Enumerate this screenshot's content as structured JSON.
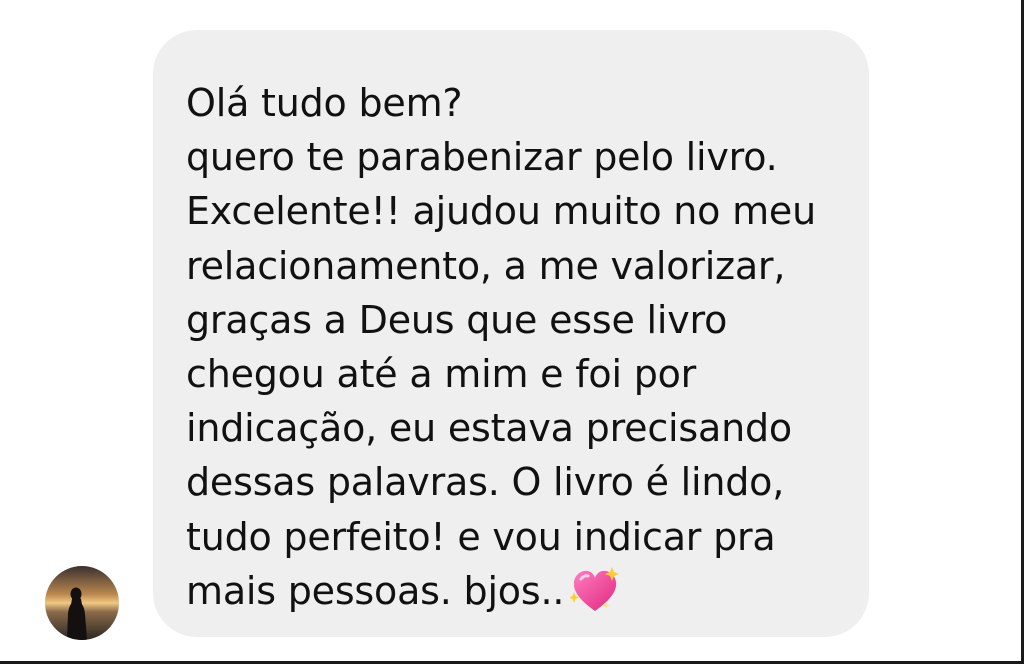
{
  "message": {
    "lines": [
      "Olá tudo bem?",
      "quero te parabenizar pelo livro.",
      "Excelente!! ajudou muito no meu",
      "relacionamento, a me valorizar,",
      "graças a Deus que esse livro",
      "chegou até a mim e foi por",
      "indicação, eu estava precisando",
      "dessas palavras. O livro é lindo,",
      "tudo perfeito! e vou indicar pra",
      "mais pessoas. bjos.."
    ],
    "emoji": "sparkling-heart-icon"
  },
  "sender": {
    "avatar": "avatar-silhouette-sunset"
  },
  "colors": {
    "bubble": "#efefef",
    "text": "#111111",
    "heart": "#f0479a"
  }
}
